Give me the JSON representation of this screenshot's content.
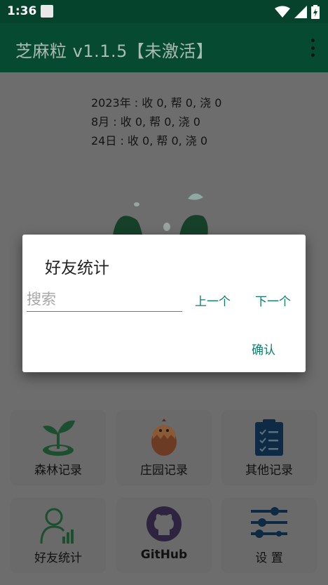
{
  "status_bar": {
    "time": "1:36"
  },
  "app_bar": {
    "title": "芝麻粒 v1.1.5【未激活】",
    "overflow_icon": "more-vert-icon"
  },
  "stats": {
    "year": "2023年 : 收 0,  帮 0,  浇 0",
    "month": "8月 : 收 0,  帮 0,  浇 0",
    "day": "24日 : 收 0,  帮 0,  浇 0"
  },
  "tiles": [
    {
      "label": "森林记录",
      "icon": "sprout-icon"
    },
    {
      "label": "庄园记录",
      "icon": "chick-egg-icon"
    },
    {
      "label": "其他记录",
      "icon": "clipboard-checklist-icon"
    },
    {
      "label": "好友统计",
      "icon": "user-stats-icon"
    },
    {
      "label": "GitHub",
      "icon": "github-icon"
    },
    {
      "label": "设 置",
      "icon": "sliders-icon"
    }
  ],
  "dialog": {
    "title": "好友统计",
    "search_placeholder": "搜索",
    "prev_label": "上一个",
    "next_label": "下一个",
    "confirm_label": "确认"
  },
  "colors": {
    "app_bar": "#064a31",
    "accent": "#0b7f6a",
    "icon_green": "#1b4f30"
  }
}
